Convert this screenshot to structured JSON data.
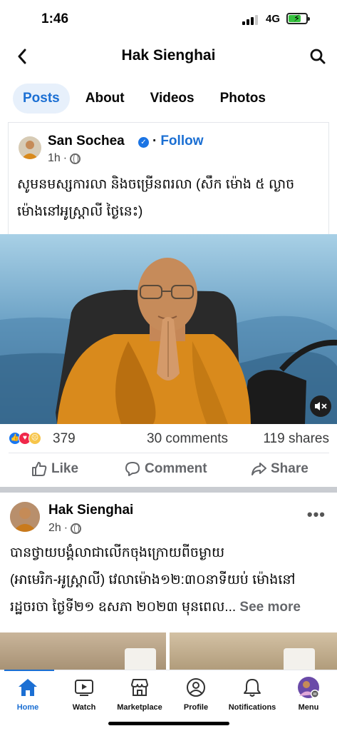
{
  "status_bar": {
    "time": "1:46",
    "network": "4G"
  },
  "header": {
    "title": "Hak Sienghai",
    "back_icon": "chevron-left-icon",
    "search_icon": "search-icon"
  },
  "tabs": [
    {
      "label": "Posts",
      "active": true
    },
    {
      "label": "About",
      "active": false
    },
    {
      "label": "Videos",
      "active": false
    },
    {
      "label": "Photos",
      "active": false
    }
  ],
  "post1": {
    "author": "San Sochea",
    "follow_label": "Follow",
    "separator": "·",
    "time": "1h",
    "text_line1": "សូមនមស្សការលា និងចម្រើនពរលា (សឹក ម៉ោង ៥ ល្ងាច",
    "text_line2": "ម៉ោងនៅអូស្ត្រាលី ថ្ងៃនេះ)",
    "reactions_count": "379",
    "comments": "30 comments",
    "shares": "119 shares",
    "like_label": "Like",
    "comment_label": "Comment",
    "share_label": "Share"
  },
  "post2": {
    "author": "Hak Sienghai",
    "time": "2h",
    "more": "•••",
    "text_line1": "បានថ្វាយបង្គំលាជាលើកចុងក្រោយពីចម្ងាយ",
    "text_line2": "(អាមេរិក-អូស្ត្រាលី) វេលាម៉ោង១២:៣០នាទីយប់ ម៉ោងនៅ",
    "text_line3": "រដ្ឋចរចា ថ្ងៃទី២១ ឧសភា ២០២៣ មុនពេល...",
    "see_more": "See more"
  },
  "bottom_nav": [
    {
      "label": "Home",
      "icon": "home-icon",
      "active": true
    },
    {
      "label": "Watch",
      "icon": "watch-icon",
      "active": false
    },
    {
      "label": "Marketplace",
      "icon": "marketplace-icon",
      "active": false
    },
    {
      "label": "Profile",
      "icon": "profile-icon",
      "active": false
    },
    {
      "label": "Notifications",
      "icon": "bell-icon",
      "active": false
    },
    {
      "label": "Menu",
      "icon": "menu-avatar-icon",
      "active": false
    }
  ],
  "colors": {
    "accent": "#1b6fd3",
    "active_tab_bg": "#e7f0fb",
    "robe": "#d98a1c"
  }
}
